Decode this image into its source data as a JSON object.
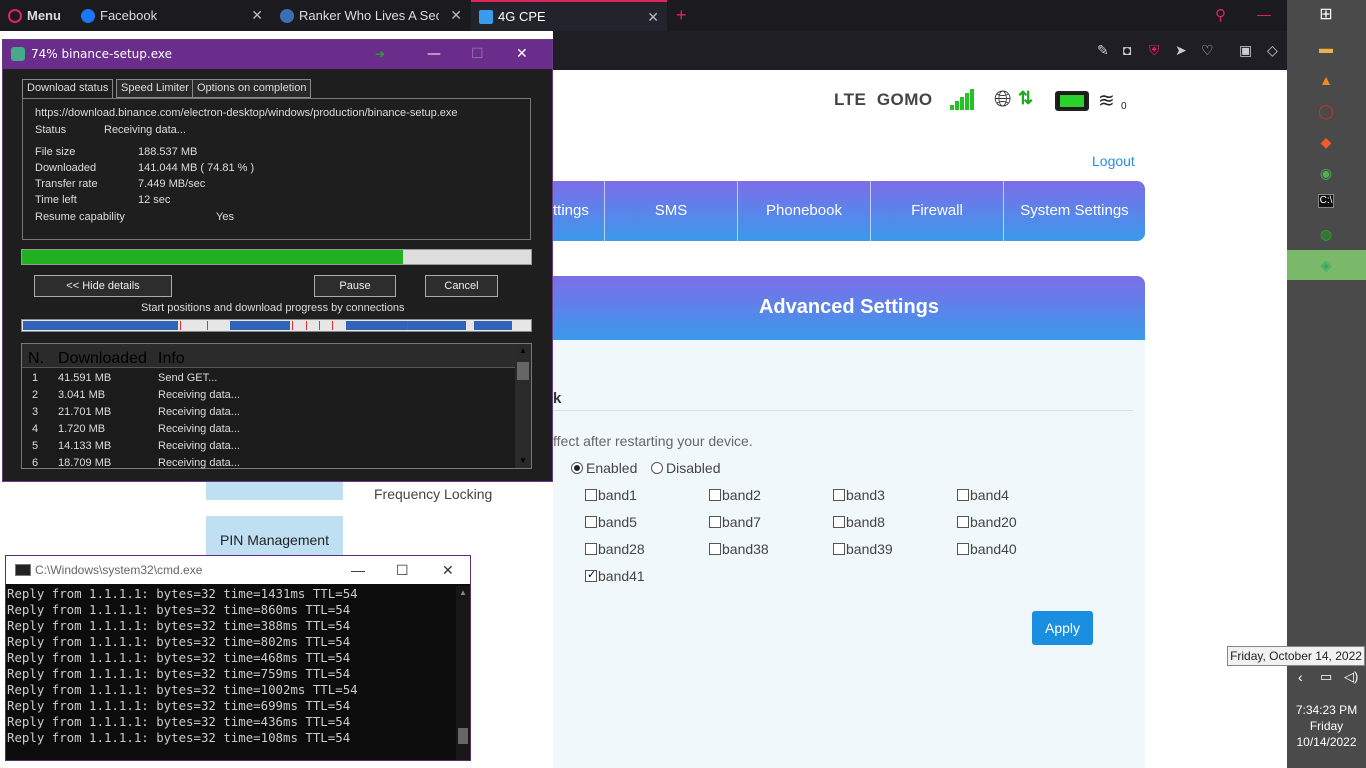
{
  "browser": {
    "menu_label": "Menu",
    "tabs": [
      {
        "label": "Facebook",
        "close": "✕"
      },
      {
        "label": "Ranker Who Lives A Second",
        "close": "✕"
      },
      {
        "label": "4G CPE",
        "close": "✕"
      }
    ],
    "new_tab": "+"
  },
  "router": {
    "network_type": "LTE",
    "carrier": "GOMO",
    "wifi_clients": "0",
    "logout": "Logout",
    "nav": [
      "ttings",
      "SMS",
      "Phonebook",
      "Firewall",
      "System Settings"
    ],
    "section_title": "Advanced Settings",
    "subsection_fragment": "k",
    "restart_note": "ffect after restarting your device.",
    "sidebar_items": [
      "",
      "PIN Management"
    ],
    "radio_enabled": "Enabled",
    "radio_disabled": "Disabled",
    "freq_label": "Frequency Locking",
    "bands": [
      {
        "label": "band1",
        "checked": false
      },
      {
        "label": "band2",
        "checked": false
      },
      {
        "label": "band3",
        "checked": false
      },
      {
        "label": "band4",
        "checked": false
      },
      {
        "label": "band5",
        "checked": false
      },
      {
        "label": "band7",
        "checked": false
      },
      {
        "label": "band8",
        "checked": false
      },
      {
        "label": "band20",
        "checked": false
      },
      {
        "label": "band28",
        "checked": false
      },
      {
        "label": "band38",
        "checked": false
      },
      {
        "label": "band39",
        "checked": false
      },
      {
        "label": "band40",
        "checked": false
      },
      {
        "label": "band41",
        "checked": true
      }
    ],
    "apply": "Apply"
  },
  "idm": {
    "title": "74% binance-setup.exe",
    "tabs": [
      "Download status",
      "Speed Limiter",
      "Options on completion"
    ],
    "url": "https://download.binance.com/electron-desktop/windows/production/binance-setup.exe",
    "status_label": "Status",
    "status_value": "Receiving data...",
    "file_size_label": "File size",
    "file_size": "188.537  MB",
    "downloaded_label": "Downloaded",
    "downloaded": "141.044  MB  ( 74.81 % )",
    "rate_label": "Transfer rate",
    "rate": "7.449  MB/sec",
    "time_left_label": "Time left",
    "time_left": "12 sec",
    "resume_label": "Resume capability",
    "resume": "Yes",
    "progress_pct": 74.81,
    "hide_details": "<< Hide details",
    "pause": "Pause",
    "cancel": "Cancel",
    "connections_caption": "Start positions and download progress by connections",
    "list_headers": [
      "N.",
      "Downloaded",
      "Info"
    ],
    "connections": [
      {
        "n": "1",
        "downloaded": "41.591  MB",
        "info": "Send GET..."
      },
      {
        "n": "2",
        "downloaded": "3.041  MB",
        "info": "Receiving data..."
      },
      {
        "n": "3",
        "downloaded": "21.701  MB",
        "info": "Receiving data..."
      },
      {
        "n": "4",
        "downloaded": "1.720  MB",
        "info": "Receiving data..."
      },
      {
        "n": "5",
        "downloaded": "14.133  MB",
        "info": "Receiving data..."
      },
      {
        "n": "6",
        "downloaded": "18.709  MB",
        "info": "Receiving data..."
      }
    ]
  },
  "cmd": {
    "title": "C:\\Windows\\system32\\cmd.exe",
    "lines": [
      "Reply from 1.1.1.1: bytes=32 time=1431ms TTL=54",
      "Reply from 1.1.1.1: bytes=32 time=860ms TTL=54",
      "Reply from 1.1.1.1: bytes=32 time=388ms TTL=54",
      "Reply from 1.1.1.1: bytes=32 time=802ms TTL=54",
      "Reply from 1.1.1.1: bytes=32 time=468ms TTL=54",
      "Reply from 1.1.1.1: bytes=32 time=759ms TTL=54",
      "Reply from 1.1.1.1: bytes=32 time=1002ms TTL=54",
      "Reply from 1.1.1.1: bytes=32 time=699ms TTL=54",
      "Reply from 1.1.1.1: bytes=32 time=436ms TTL=54",
      "Reply from 1.1.1.1: bytes=32 time=108ms TTL=54"
    ]
  },
  "taskbar": {
    "tooltip": "Friday, October 14, 2022",
    "time": "7:34:23 PM",
    "day": "Friday",
    "date": "10/14/2022"
  },
  "colors": {
    "accent": "#1a8ee0",
    "idm_title": "#6b2d8c",
    "progress": "#1fb11f"
  }
}
